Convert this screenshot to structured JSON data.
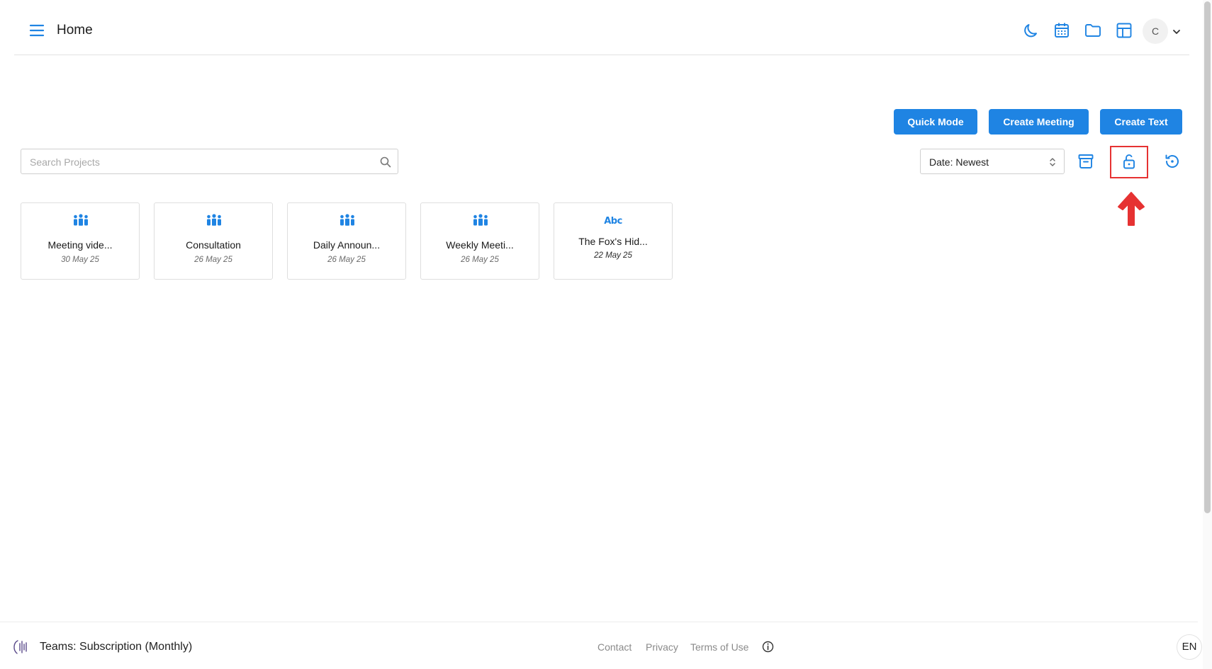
{
  "header": {
    "title": "Home",
    "icons": [
      "menu-icon",
      "moon-icon",
      "calendar-icon",
      "folder-icon",
      "table-icon"
    ],
    "avatar_initial": "C"
  },
  "actions": {
    "quick_mode": "Quick Mode",
    "create_meeting": "Create Meeting",
    "create_text": "Create Text"
  },
  "search": {
    "placeholder": "Search Projects",
    "value": ""
  },
  "sort": {
    "selected": "Date: Newest"
  },
  "toolbar_icons": [
    "archive-icon",
    "unlock-icon",
    "history-icon"
  ],
  "projects": [
    {
      "icon": "people-icon",
      "title": "Meeting vide...",
      "date": "30 May 25"
    },
    {
      "icon": "people-icon",
      "title": "Consultation",
      "date": "26 May 25"
    },
    {
      "icon": "people-icon",
      "title": "Daily Announ...",
      "date": "26 May 25"
    },
    {
      "icon": "people-icon",
      "title": "Weekly Meeti...",
      "date": "26 May 25"
    },
    {
      "icon": "abc-icon",
      "icon_text": "Abc",
      "title": "The Fox's Hid...",
      "date": "22 May 25"
    }
  ],
  "footer": {
    "plan": "Teams: Subscription (Monthly)",
    "links": {
      "contact": "Contact",
      "privacy": "Privacy",
      "terms": "Terms of Use"
    },
    "language": "EN"
  },
  "colors": {
    "accent": "#1f84e3",
    "highlight": "#e63232"
  }
}
